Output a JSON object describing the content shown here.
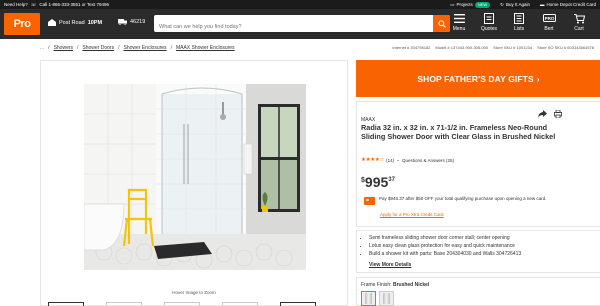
{
  "topbar": {
    "need_help": "Need Help?",
    "call": "Call",
    "phone": "1-866-333-3551",
    "or_text": "or Text",
    "text_number": "79496",
    "projects": "Projects",
    "new_badge": "NEW",
    "buy_again": "Buy It Again",
    "card": "Home Depot Credit Card"
  },
  "header": {
    "logo_text": "Pro",
    "store_name": "Post Road",
    "store_hours": "10PM",
    "zip": "46219",
    "search_placeholder": "What can we help you find today?",
    "nav": [
      {
        "label": "Menu"
      },
      {
        "label": "Quotes"
      },
      {
        "label": "Lists"
      },
      {
        "label": "Bert"
      },
      {
        "label": "Cart"
      }
    ]
  },
  "breadcrumbs": {
    "items": [
      "...",
      "Showers",
      "Shower Doors",
      "Shower Enclosures",
      "MAAX Shower Enclosures"
    ],
    "internet": "Internet # 304798182",
    "model": "Model # 137443-900-305-000",
    "store_sku": "Store SKU # 1001234",
    "store_so": "Store SO SKU # 603143664578"
  },
  "gallery": {
    "hover_note": "Hover Image to Zoom"
  },
  "product": {
    "promo": "SHOP FATHER'S DAY GIFTS",
    "brand": "MAAX",
    "title": "Radia 32 in. x 32 in. x 71-1/2 in. Frameless Neo-Round Sliding Shower Door with Clear Glass in Brushed Nickel",
    "stars": "★★★★☆",
    "review_count": "(14)",
    "qa": "Questions & Answers (25)",
    "price_currency": "$",
    "price_dollars": "995",
    "price_cents": "37",
    "credit_text": "Pay $945.37 after $50 OFF your total qualifying purchase upon opening a new card.",
    "apply_link": "Apply for a Pro Xtra Credit Card",
    "bullets": [
      "Semi frameless sliding shower door corner stall; center opening",
      "Lotus easy clean glass protection for easy and quick maintenance",
      "Build a shower kit with parts: Base 204304030 and Walls 304726413"
    ],
    "view_more": "View More Details",
    "finish_label": "Frame Finish:",
    "finish_value": "Brushed Nickel"
  },
  "colors": {
    "brand_orange": "#f96302",
    "header_dark": "#2b2b2b"
  }
}
